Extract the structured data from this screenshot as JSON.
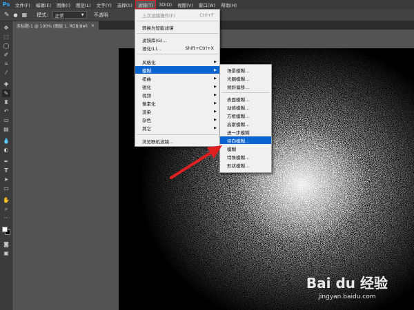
{
  "app": {
    "logo": "Ps"
  },
  "menubar": {
    "items": [
      {
        "label": "文件(F)"
      },
      {
        "label": "编辑(E)"
      },
      {
        "label": "图像(I)"
      },
      {
        "label": "图层(L)"
      },
      {
        "label": "文字(Y)"
      },
      {
        "label": "选择(S)"
      },
      {
        "label": "滤镜(T)"
      },
      {
        "label": "3D(D)"
      },
      {
        "label": "视图(V)"
      },
      {
        "label": "窗口(W)"
      },
      {
        "label": "帮助(H)"
      }
    ]
  },
  "options": {
    "mode_label": "模式:",
    "mode_value": "正常",
    "opacity_label": "不透明"
  },
  "document": {
    "tab_label": "未标题-1 @ 100% (图层 1, RGB/8#)",
    "close": "×"
  },
  "filter_menu": {
    "items": [
      {
        "label": "上次滤镜操作(F)",
        "shortcut": "Ctrl+F"
      },
      {
        "label": "转换为智能滤镜"
      },
      {
        "label": "滤镜库(G)..."
      },
      {
        "label": "液化(L)...",
        "shortcut": "Shift+Ctrl+X"
      },
      {
        "label": "风格化"
      },
      {
        "label": "模糊"
      },
      {
        "label": "扭曲"
      },
      {
        "label": "锐化"
      },
      {
        "label": "视频"
      },
      {
        "label": "像素化"
      },
      {
        "label": "渲染"
      },
      {
        "label": "杂色"
      },
      {
        "label": "其它"
      },
      {
        "label": "浏览联机滤镜..."
      }
    ]
  },
  "blur_submenu": {
    "items": [
      {
        "label": "场景模糊..."
      },
      {
        "label": "光圈模糊..."
      },
      {
        "label": "倾斜偏移..."
      },
      {
        "label": "表面模糊..."
      },
      {
        "label": "动感模糊..."
      },
      {
        "label": "方框模糊..."
      },
      {
        "label": "高斯模糊..."
      },
      {
        "label": "进一步模糊"
      },
      {
        "label": "径向模糊..."
      },
      {
        "label": "模糊"
      },
      {
        "label": "特殊模糊..."
      },
      {
        "label": "形状模糊..."
      }
    ]
  },
  "watermark": {
    "logo": "Bai du 经验",
    "url": "jingyan.baidu.com"
  },
  "colors": {
    "highlight": "#0a64d0",
    "annotation": "#e02020"
  }
}
